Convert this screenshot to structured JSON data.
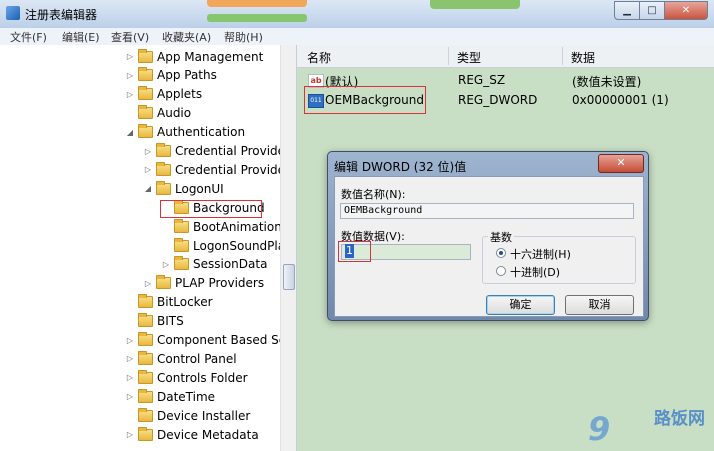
{
  "window": {
    "title": "注册表编辑器"
  },
  "menu": [
    "文件(F)",
    "编辑(E)",
    "查看(V)",
    "收藏夹(A)",
    "帮助(H)"
  ],
  "tree": [
    {
      "label": "App Management",
      "indent": 0,
      "expander": "▷"
    },
    {
      "label": "App Paths",
      "indent": 0,
      "expander": "▷"
    },
    {
      "label": "Applets",
      "indent": 0,
      "expander": "▷"
    },
    {
      "label": "Audio",
      "indent": 0,
      "expander": ""
    },
    {
      "label": "Authentication",
      "indent": 0,
      "expander": "◢"
    },
    {
      "label": "Credential Provider",
      "indent": 1,
      "expander": "▷"
    },
    {
      "label": "Credential Provider",
      "indent": 1,
      "expander": "▷"
    },
    {
      "label": "LogonUI",
      "indent": 1,
      "expander": "◢"
    },
    {
      "label": "Background",
      "indent": 2,
      "expander": "",
      "selected": true
    },
    {
      "label": "BootAnimation",
      "indent": 2,
      "expander": ""
    },
    {
      "label": "LogonSoundPlay",
      "indent": 2,
      "expander": ""
    },
    {
      "label": "SessionData",
      "indent": 2,
      "expander": "▷"
    },
    {
      "label": "PLAP Providers",
      "indent": 1,
      "expander": "▷"
    },
    {
      "label": "BitLocker",
      "indent": 0,
      "expander": ""
    },
    {
      "label": "BITS",
      "indent": 0,
      "expander": ""
    },
    {
      "label": "Component Based Ser",
      "indent": 0,
      "expander": "▷"
    },
    {
      "label": "Control Panel",
      "indent": 0,
      "expander": "▷"
    },
    {
      "label": "Controls Folder",
      "indent": 0,
      "expander": "▷"
    },
    {
      "label": "DateTime",
      "indent": 0,
      "expander": "▷"
    },
    {
      "label": "Device Installer",
      "indent": 0,
      "expander": ""
    },
    {
      "label": "Device Metadata",
      "indent": 0,
      "expander": "▷"
    }
  ],
  "columns": {
    "name": "名称",
    "type": "类型",
    "data": "数据"
  },
  "values": [
    {
      "icon": "string-value-icon",
      "name": "(默认)",
      "type": "REG_SZ",
      "data": "(数值未设置)"
    },
    {
      "icon": "binary-value-icon",
      "name": "OEMBackground",
      "type": "REG_DWORD",
      "data": "0x00000001 (1)"
    }
  ],
  "dialog": {
    "title": "编辑 DWORD (32 位)值",
    "close": "✕",
    "name_label": "数值名称(N):",
    "name_value": "OEMBackground",
    "data_label": "数值数据(V):",
    "data_value": "1",
    "base_label": "基数",
    "hex_label": "十六进制(H)",
    "dec_label": "十进制(D)",
    "hex_selected": true,
    "ok": "确定",
    "cancel": "取消"
  },
  "watermark": {
    "number": "9",
    "text": "路饭网"
  }
}
